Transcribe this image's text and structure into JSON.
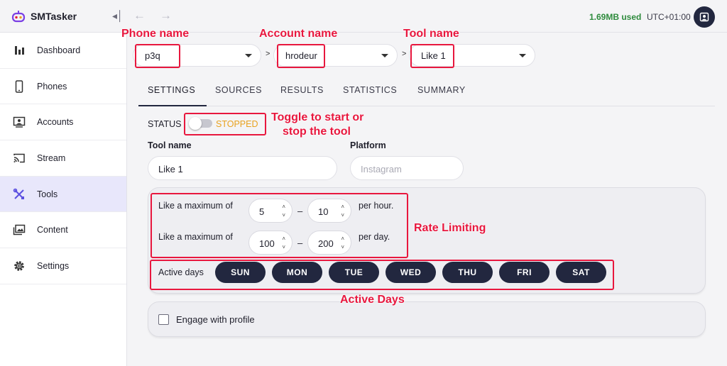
{
  "app": {
    "title": "SMTasker",
    "storage_used": "1.69MB used",
    "timezone": "UTC+01:00"
  },
  "sidebar": {
    "items": [
      {
        "label": "Dashboard",
        "icon": "bar-chart-icon"
      },
      {
        "label": "Phones",
        "icon": "phone-icon"
      },
      {
        "label": "Accounts",
        "icon": "account-card-icon"
      },
      {
        "label": "Stream",
        "icon": "cast-icon"
      },
      {
        "label": "Tools",
        "icon": "tools-icon",
        "active": true
      },
      {
        "label": "Content",
        "icon": "images-icon"
      },
      {
        "label": "Settings",
        "icon": "gear-icon"
      }
    ]
  },
  "selectors": {
    "phone": "p3q",
    "account": "hrodeur",
    "tool": "Like 1",
    "separator": ">"
  },
  "tabs": [
    "SETTINGS",
    "SOURCES",
    "RESULTS",
    "STATISTICS",
    "SUMMARY"
  ],
  "settings": {
    "status_label": "STATUS",
    "status_value": "STOPPED",
    "tool_name_label": "Tool name",
    "tool_name_value": "Like 1",
    "platform_label": "Platform",
    "platform_placeholder": "Instagram",
    "rate": {
      "row1_label": "Like a maximum of",
      "row1_min": "5",
      "row1_max": "10",
      "row1_unit": "per hour.",
      "row2_label": "Like a maximum of",
      "row2_min": "100",
      "row2_max": "200",
      "row2_unit": "per day.",
      "dash": "–"
    },
    "active_days_label": "Active days",
    "days": [
      "SUN",
      "MON",
      "TUE",
      "WED",
      "THU",
      "FRI",
      "SAT"
    ],
    "engage_label": "Engage with profile"
  },
  "annotations": {
    "phone_name": "Phone name",
    "account_name": "Account name",
    "tool_name": "Tool name",
    "toggle_line1": "Toggle to start or",
    "toggle_line2": "stop the tool",
    "rate_limiting": "Rate Limiting",
    "active_days": "Active Days"
  },
  "colors": {
    "accent": "#22273f",
    "annotation": "#e8173e",
    "stopped": "#e9a21f",
    "used": "#2e8b3d",
    "active_nav": "#e8e7fb"
  }
}
